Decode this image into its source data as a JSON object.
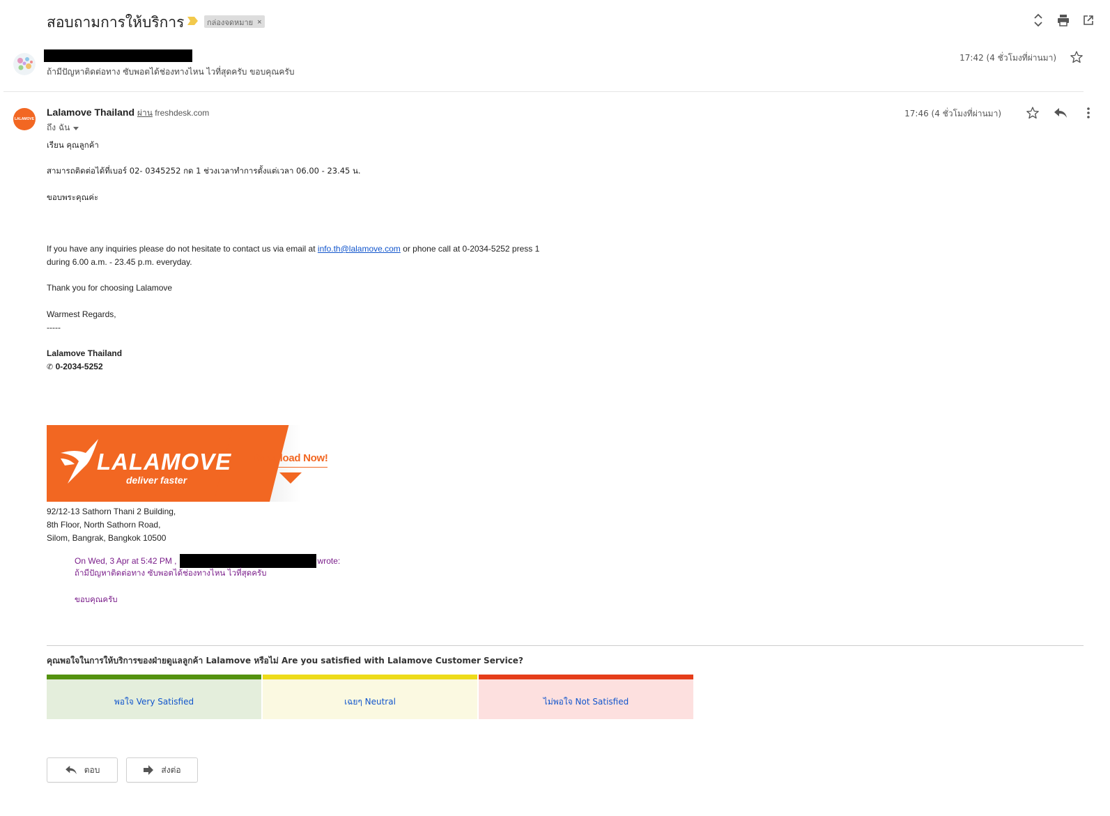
{
  "thread": {
    "subject": "สอบถามการให้บริการ",
    "label": "กล่องจดหมาย",
    "label_close": "×"
  },
  "toolbar_icons": [
    "expand-collapse-icon",
    "print-icon",
    "open-in-new-window-icon"
  ],
  "message1": {
    "snippet": "ถ้ามีปัญหาติดต่อทาง ซับพอตได้ช่องทางไหน ไวที่สุดครับ ขอบคุณครับ",
    "time": "17:42 (4 ชั่วโมงที่ผ่านมา)"
  },
  "message2": {
    "sender_name": "Lalamove Thailand",
    "via_word": "ผ่าน",
    "via_domain": "freshdesk.com",
    "recipient": "ถึง ฉัน",
    "avatar_text": "LALAMOVE",
    "time": "17:46 (4 ชั่วโมงที่ผ่านมา)",
    "body": {
      "greeting": "เรียน คุณลูกค้า",
      "thai_contact": "สามารถติดต่อได้ที่เบอร์ 02- 0345252 กด 1 ช่วงเวลาทำการตั้งแต่เวลา 06.00 - 23.45 น.",
      "thai_thanks": "ขอบพระคุณค่ะ",
      "en_line1_pre": "If you have any inquiries please do not hesitate to contact us via email at ",
      "en_email": "info.th@lalamove.com",
      "en_line1_post": " or phone call at 0-2034-5252 press 1",
      "en_line2": "during 6.00 a.m. - 23.45 p.m. everyday.",
      "thank_you": "Thank you for choosing Lalamove",
      "regards": "Warmest Regards,",
      "dashes": "-----",
      "sig_name": "Lalamove Thailand",
      "sig_phone_icon": "✆",
      "sig_phone": "0-2034-5252"
    },
    "banner": {
      "brand": "LALAMOVE",
      "tagline": "deliver faster",
      "cta": "Download Now!"
    },
    "address": {
      "line1": "92/12-13 Sathorn Thani 2 Building,",
      "line2": "8th Floor, North Sathorn Road,",
      "line3": "Silom, Bangrak, Bangkok 10500"
    },
    "quote": {
      "on_text": "On Wed, 3 Apr at 5:42 PM ,",
      "wrote": "wrote:",
      "line1": "ถ้ามีปัญหาติดต่อทาง ซับพอตได้ช่องทางไหน ไวที่สุดครับ",
      "line2": "ขอบคุณครับ"
    },
    "survey": {
      "question": "คุณพอใจในการให้บริการของฝ่ายดูแลลูกค้า Lalamove หรือไม่ Are you satisfied with Lalamove Customer Service?",
      "options": [
        {
          "label": "พอใจ Very Satisfied",
          "color": "#54920f"
        },
        {
          "label": "เฉยๆ Neutral",
          "color": "#eddb1a"
        },
        {
          "label": "ไม่พอใจ Not Satisfied",
          "color": "#e53d1a"
        }
      ]
    }
  },
  "actions": {
    "reply": "ตอบ",
    "forward": "ส่งต่อ"
  }
}
